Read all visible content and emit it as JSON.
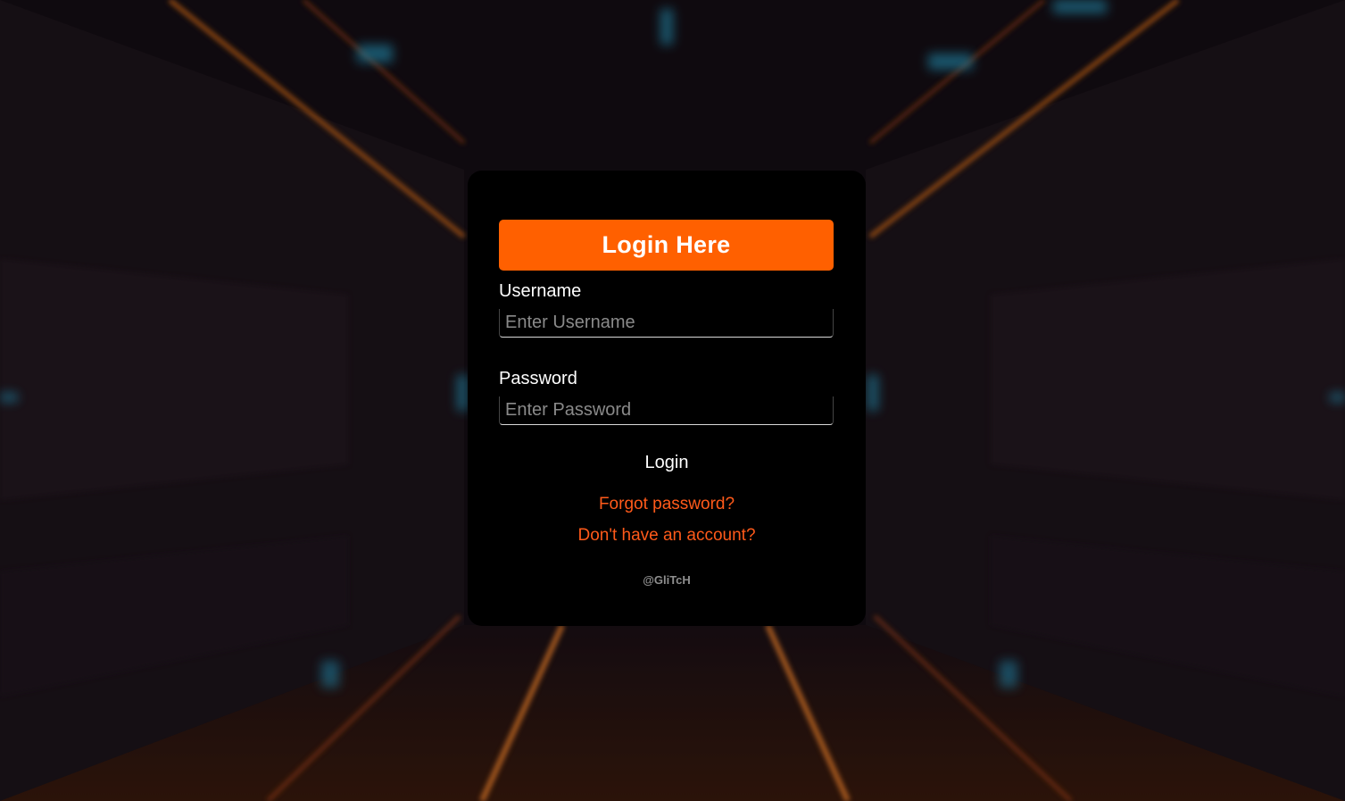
{
  "form": {
    "title": "Login Here",
    "username_label": "Username",
    "username_placeholder": "Enter Username",
    "username_value": "",
    "password_label": "Password",
    "password_placeholder": "Enter Password",
    "password_value": "",
    "submit_label": "Login",
    "forgot_link": "Forgot password?",
    "signup_link": "Don't have an account?",
    "credit": "@GliTcH"
  },
  "colors": {
    "accent": "#ff6000",
    "link": "#ff5a1a",
    "card": "#000000",
    "text": "#ffffff"
  }
}
